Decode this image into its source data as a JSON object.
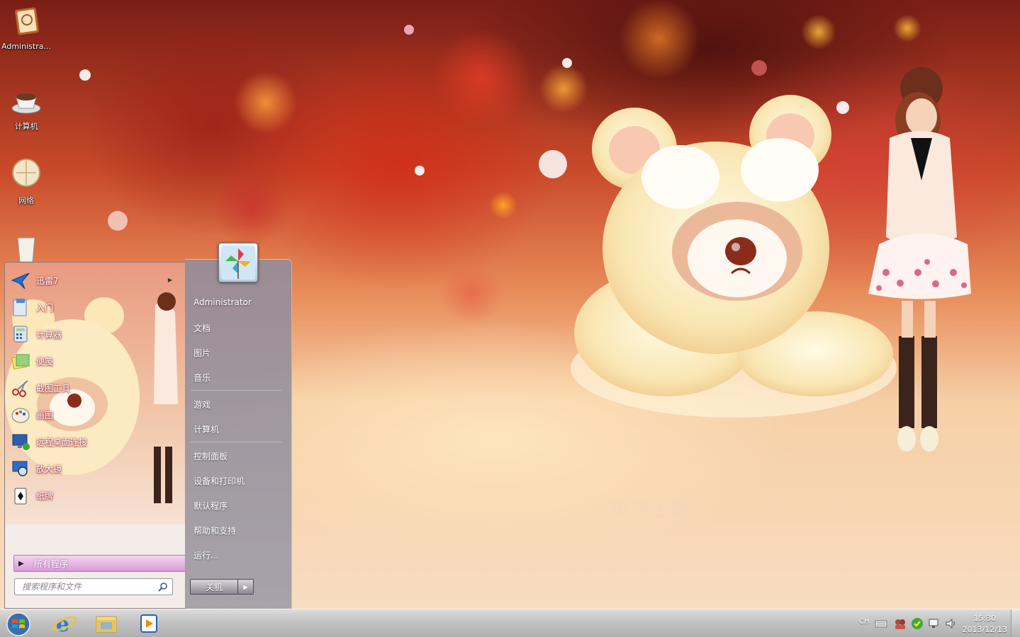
{
  "desktop": {
    "icons": [
      {
        "label": "Administra...",
        "icon": "user-folder-icon"
      },
      {
        "label": "计算机",
        "icon": "computer-icon"
      },
      {
        "label": "网络",
        "icon": "network-icon"
      },
      {
        "label": "",
        "icon": "recycle-bin-icon"
      }
    ],
    "watermark": "美丽主题"
  },
  "start_menu": {
    "programs": [
      {
        "label": "迅雷7",
        "icon": "thunder-bird-icon",
        "has_submenu": true
      },
      {
        "label": "入门",
        "icon": "getting-started-icon"
      },
      {
        "label": "计算器",
        "icon": "calculator-icon"
      },
      {
        "label": "便笺",
        "icon": "sticky-notes-icon"
      },
      {
        "label": "截图工具",
        "icon": "snipping-tool-icon"
      },
      {
        "label": "画图",
        "icon": "paint-icon"
      },
      {
        "label": "远程桌面连接",
        "icon": "remote-desktop-icon"
      },
      {
        "label": "放大镜",
        "icon": "magnifier-icon"
      },
      {
        "label": "纸牌",
        "icon": "solitaire-icon"
      }
    ],
    "all_programs": "所有程序",
    "search_placeholder": "搜索程序和文件",
    "places_group1": [
      "Administrator",
      "文档",
      "图片",
      "音乐"
    ],
    "places_group2": [
      "游戏",
      "计算机"
    ],
    "places_group3": [
      "控制面板",
      "设备和打印机",
      "默认程序",
      "帮助和支持",
      "运行..."
    ],
    "shutdown_label": "关机"
  },
  "taskbar": {
    "start_icon": "windows-start-orb-icon",
    "pinned": [
      "internet-explorer-icon",
      "file-explorer-icon",
      "media-player-icon"
    ],
    "language": "CH",
    "tray_icons": [
      "keyboard-icon",
      "user-avatars-icon",
      "security-shield-icon",
      "network-tray-icon",
      "volume-icon"
    ],
    "time": "15:30",
    "date": "2013/12/13"
  }
}
